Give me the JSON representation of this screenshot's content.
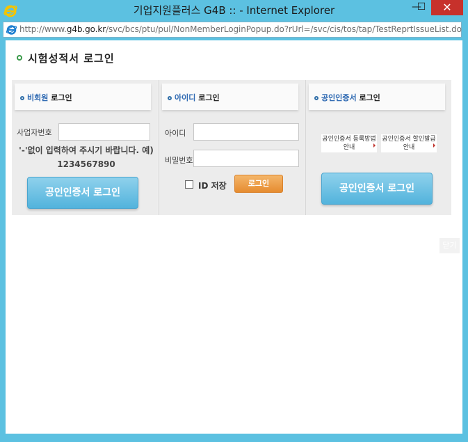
{
  "window": {
    "title": "기업지원플러스 G4B :: - Internet Explorer",
    "minimize": "—",
    "maximize": "☐",
    "close": "✕"
  },
  "address": {
    "prefix": "http://www.",
    "domain": "g4b.go.kr",
    "path": "/svc/bcs/ptu/pul/NonMemberLoginPopup.do?rUrl=/svc/cis/tos/tap/TestReprtIssueList.do"
  },
  "page": {
    "title": "시험성적서 로그인",
    "close_label": "닫기"
  },
  "panels": {
    "nonmember": {
      "title_accent": "비회원",
      "title_rest": " 로그인",
      "bizno_label": "사업자번호",
      "bizno_value": "",
      "hint": "'-'없이 입력하여 주시기 바랍니다.   예) 1234567890",
      "cert_button": "공인인증서 로그인"
    },
    "id_login": {
      "title_accent": "아이디",
      "title_rest": " 로그인",
      "id_label": "아이디",
      "id_value": "",
      "pw_label": "비밀번호",
      "pw_value": "",
      "save_id_label": "ID 저장",
      "login_button": "로그인"
    },
    "cert_login": {
      "title_accent": "공인인증서",
      "title_rest": " 로그인",
      "register_link": "공인인증서 등록방법 안내",
      "discount_link": "공인인증서 할인발급안내",
      "cert_button": "공인인증서 로그인"
    }
  },
  "colors": {
    "window_frame": "#5cc1e1",
    "close_button": "#c7312b",
    "accent_blue": "#2b67b1",
    "cert_button": "#52b3dc",
    "login_button": "#e68c30"
  }
}
